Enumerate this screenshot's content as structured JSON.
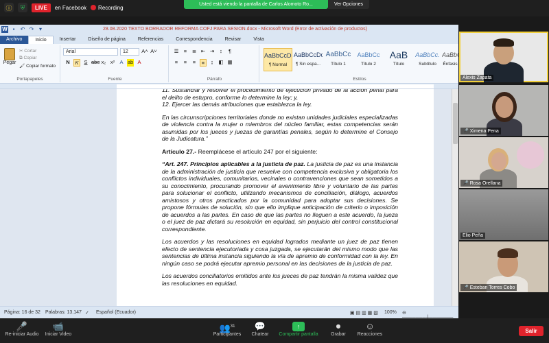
{
  "zoom": {
    "live_label": "LIVE",
    "live_target": "en Facebook",
    "recording_label": "Recording",
    "share_banner": "Usted está viendo la pantalla de Carlos Alomoto Ro...",
    "view_options": "Ver Opciones",
    "bottom": {
      "audio": "Re-iniciar Audio",
      "video": "Iniciar Video",
      "participants": "Participantes",
      "participants_count": "31",
      "chat": "Chatear",
      "share": "Compartir pantalla",
      "record": "Grabar",
      "reactions": "Reacciones",
      "leave": "Salir"
    },
    "participants": [
      {
        "name": "Alexis Zapata",
        "muted": false
      },
      {
        "name": "Ximena Pena",
        "muted": true
      },
      {
        "name": "Rosa Orellana",
        "muted": true
      },
      {
        "name": "Elio Peña",
        "muted": false
      },
      {
        "name": "Esteban Torres Cobo",
        "muted": true
      }
    ]
  },
  "word": {
    "title": "28.08.2020 TEXTO BORRADOR REFORMA COFJ PARA SESION.docx - Microsoft Word (Error de activación de productos)",
    "tabs": [
      "Archivo",
      "Inicio",
      "Insertar",
      "Diseño de página",
      "Referencias",
      "Correspondencia",
      "Revisar",
      "Vista"
    ],
    "ribbon": {
      "paste": "Pegar",
      "cut": "Cortar",
      "copy": "Copiar",
      "format_painter": "Copiar formato",
      "clipboard_label": "Portapapeles",
      "font_name": "Arial",
      "font_size": "12",
      "font_label": "Fuente",
      "paragraph_label": "Párrafo",
      "styles_label": "Estilos",
      "styles": [
        {
          "sample": "AaBbCcDc",
          "name": "¶ Normal"
        },
        {
          "sample": "AaBbCcDc",
          "name": "¶ Sin espa..."
        },
        {
          "sample": "AaBbCc",
          "name": "Título 1"
        },
        {
          "sample": "AaBbCc",
          "name": "Título 2"
        },
        {
          "sample": "AaB",
          "name": "Título"
        },
        {
          "sample": "AaBbCc.",
          "name": "Subtítulo"
        },
        {
          "sample": "AaBbCcL",
          "name": "Énfasis"
        }
      ]
    },
    "document": {
      "p1": "11.      Sustanciar y resolver el procedimiento de ejecución privado de la acción penal para el delito de estupro, conforme lo determine la ley; y,",
      "p2": "12.      Ejercer las demás atribuciones que establezca la ley.",
      "p3": "En las circunscripciones territoriales donde no existan unidades judiciales especializadas de violencia contra la mujer o miembros del núcleo familiar, estas competencias serán asumidas por los jueces y juezas de garantías penales, según lo determine el Consejo de la Judicatura.”",
      "p4_bold": "Artículo 27.-",
      "p4_rest": " Reemplácese el artículo 247 por el siguiente:",
      "p5_bold": "“Art. 247. Principios aplicables a la justicia de paz.",
      "p5_rest": " La justicia de paz es una instancia de la administración de justicia que resuelve con competencia exclusiva y obligatoria los conflictos individuales, comunitarios, vecinales o contravenciones que sean sometidos a su conocimiento, procurando promover el avenimiento libre y voluntario de las partes para solucionar el conflicto, utilizando mecanismos de conciliación, diálogo, acuerdos amistosos y otros practicados por la comunidad para adoptar sus decisiones. Se propone fórmulas de solución, sin que ello implique anticipación de criterio o imposición de acuerdos a las partes. En caso de que las partes no lleguen a este acuerdo, la jueza o el juez de paz dictará su resolución en equidad, sin perjuicio del control constitucional correspondiente.",
      "p6": "Los acuerdos y las resoluciones en equidad logrados mediante un juez de paz tienen efecto de sentencia ejecutoriada y cosa juzgada, se ejecutarán del mismo modo que las sentencias de última instancia siguiendo la vía de apremio de conformidad con la ley. En ningún caso se podrá ejecutar apremio personal en las decisiones de la justicia de paz.",
      "p7": "Los acuerdos conciliatorios emitidos ante los jueces de paz tendrán la misma validez que las resoluciones en equidad."
    },
    "status": {
      "page": "Página: 16 de 32",
      "words": "Palabras: 13.147",
      "language": "Español (Ecuador)",
      "zoom": "100%"
    }
  }
}
